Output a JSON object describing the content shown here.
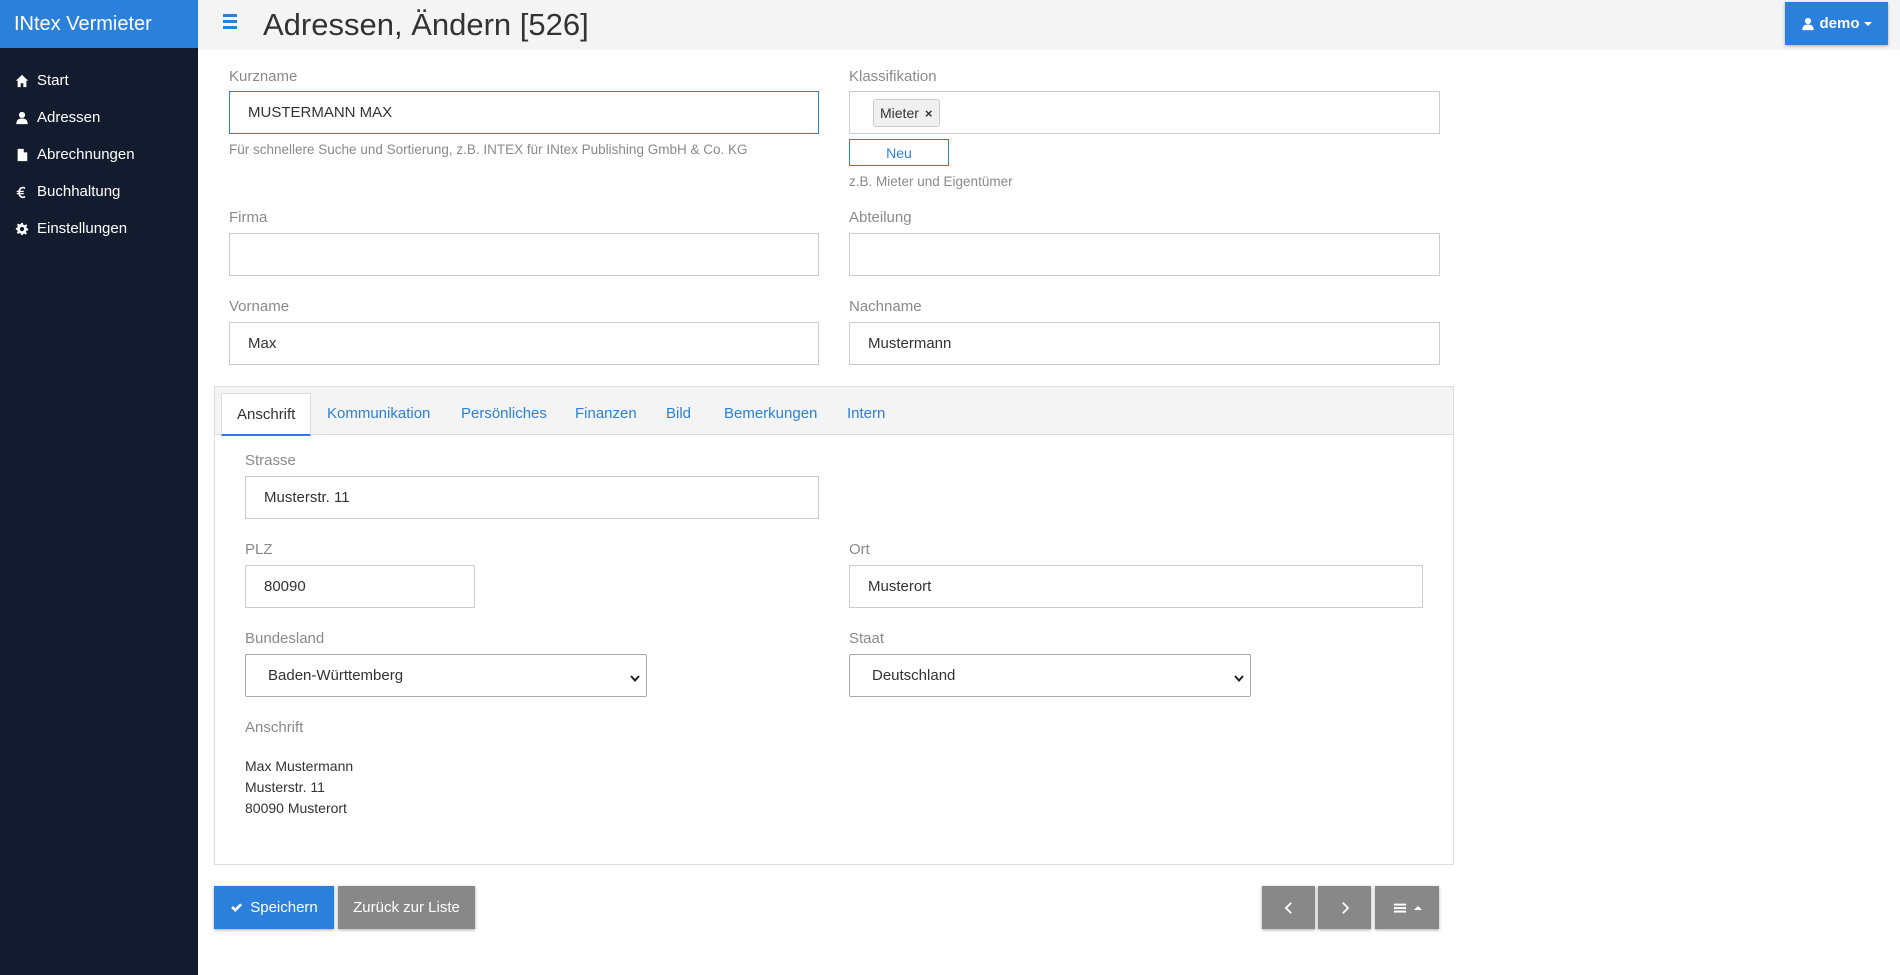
{
  "app": {
    "brand": "INtex Vermieter"
  },
  "sidebar": {
    "items": [
      {
        "label": "Start",
        "icon": "home-icon"
      },
      {
        "label": "Adressen",
        "icon": "user-icon"
      },
      {
        "label": "Abrechnungen",
        "icon": "file-icon"
      },
      {
        "label": "Buchhaltung",
        "icon": "euro-icon"
      },
      {
        "label": "Einstellungen",
        "icon": "gear-icon"
      }
    ]
  },
  "header": {
    "title": "Adressen, Ändern [526]",
    "user": "demo"
  },
  "form": {
    "kurzname": {
      "label": "Kurzname",
      "value": "MUSTERMANN MAX",
      "help": "Für schnellere Suche und Sortierung, z.B. INTEX für INtex Publishing GmbH & Co. KG"
    },
    "klassifikation": {
      "label": "Klassifikation",
      "tag": "Mieter",
      "new_button": "Neu",
      "help": "z.B. Mieter und Eigentümer"
    },
    "firma": {
      "label": "Firma",
      "value": ""
    },
    "abteilung": {
      "label": "Abteilung",
      "value": ""
    },
    "vorname": {
      "label": "Vorname",
      "value": "Max"
    },
    "nachname": {
      "label": "Nachname",
      "value": "Mustermann"
    }
  },
  "tabs": [
    "Anschrift",
    "Kommunikation",
    "Persönliches",
    "Finanzen",
    "Bild",
    "Bemerkungen",
    "Intern"
  ],
  "anschrift": {
    "strasse": {
      "label": "Strasse",
      "value": "Musterstr. 11"
    },
    "plz": {
      "label": "PLZ",
      "value": "80090"
    },
    "ort": {
      "label": "Ort",
      "value": "Musterort"
    },
    "bundesland": {
      "label": "Bundesland",
      "value": "Baden-Württemberg"
    },
    "staat": {
      "label": "Staat",
      "value": "Deutschland"
    },
    "anschrift_label": "Anschrift",
    "lines": [
      "Max Mustermann",
      "Musterstr. 11",
      "80090 Musterort"
    ]
  },
  "buttons": {
    "save": "Speichern",
    "back": "Zurück zur Liste"
  },
  "colors": {
    "accent": "#2b80db",
    "sidebar": "#131c2e",
    "gray_button": "#888888"
  }
}
